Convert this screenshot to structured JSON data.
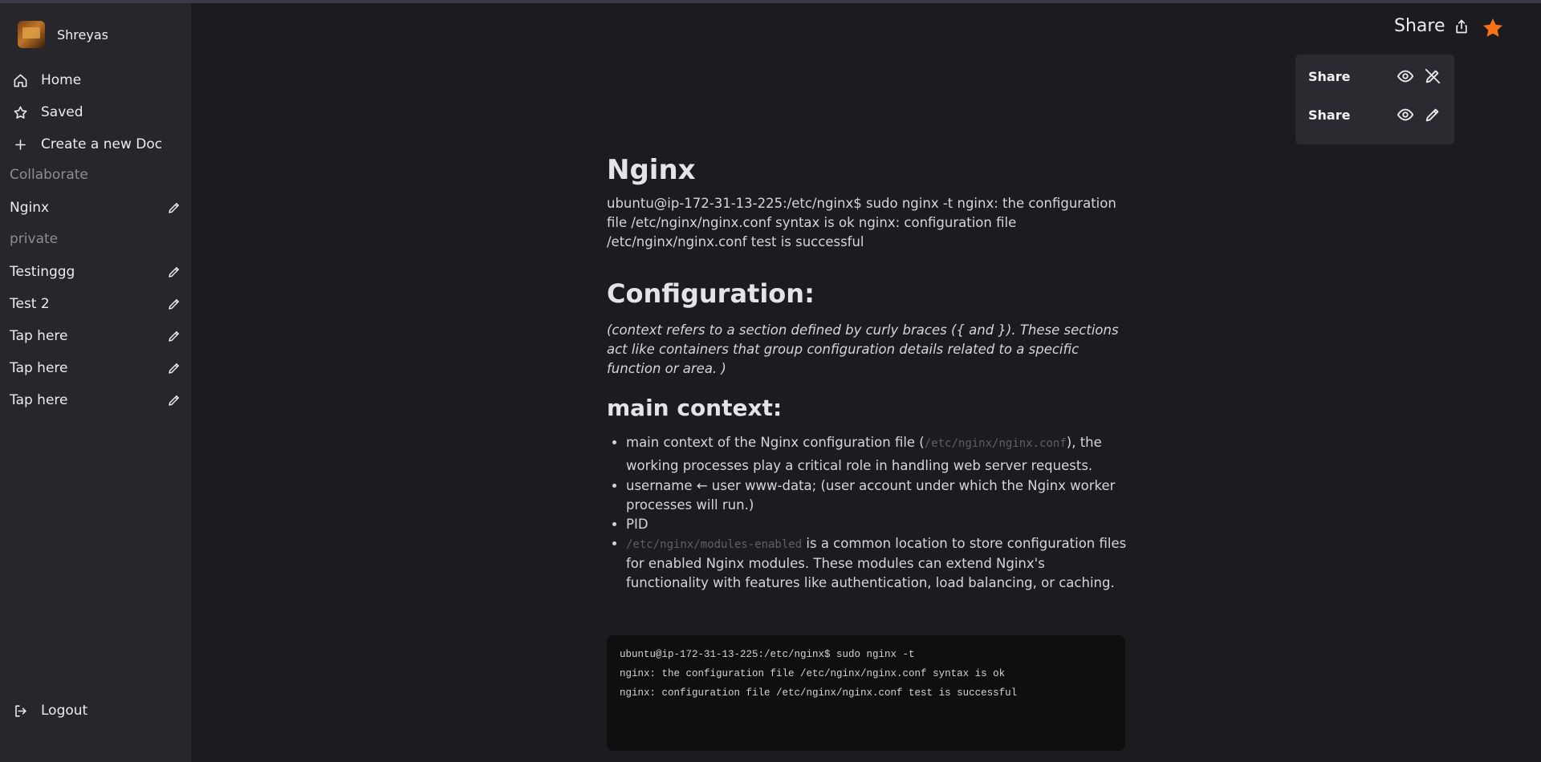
{
  "user": {
    "name": "Shreyas"
  },
  "nav": [
    {
      "label": "Home",
      "icon": "home-icon"
    },
    {
      "label": "Saved",
      "icon": "star-outline-icon"
    },
    {
      "label": "Create a new Doc",
      "icon": "plus-icon"
    }
  ],
  "sections": {
    "collaborate": "Collaborate",
    "private": "private"
  },
  "collaborate_docs": [
    {
      "label": "Nginx"
    }
  ],
  "private_docs": [
    {
      "label": "Testinggg"
    },
    {
      "label": "Test 2"
    },
    {
      "label": "Tap here"
    },
    {
      "label": "Tap here"
    },
    {
      "label": "Tap here"
    }
  ],
  "logout_label": "Logout",
  "header": {
    "share_label": "Share",
    "starred": true,
    "star_color": "#f97316"
  },
  "share_panel": [
    {
      "label": "Share",
      "icons": [
        "eye-icon",
        "edit-off-icon"
      ]
    },
    {
      "label": "Share",
      "icons": [
        "eye-icon",
        "pencil-icon"
      ]
    }
  ],
  "doc": {
    "title": "Nginx",
    "intro": "ubuntu@ip-172-31-13-225:/etc/nginx$ sudo nginx -t nginx: the configuration file /etc/nginx/nginx.conf syntax is ok nginx: configuration file /etc/nginx/nginx.conf test is successful",
    "config_heading": "Configuration:",
    "config_note": "(context refers to a section defined by curly braces ({ and }). These sections act like containers that group configuration details related to a specific function or area. )",
    "main_heading": "main context:",
    "bullets": {
      "b1_pre": "main context of the Nginx configuration file (",
      "b1_code": "/etc/nginx/nginx.conf",
      "b1_post": "), the working processes play a critical role in handling web server requests.",
      "b2": "username ← user www-data; (user account under which the Nginx worker processes will run.)",
      "b3": "PID",
      "b4_code": "/etc/nginx/modules-enabled",
      "b4_post": " is a common location to store configuration files for enabled Nginx modules. These modules can extend Nginx's functionality with features like authentication, load balancing, or caching."
    },
    "code_lines": [
      "ubuntu@ip-172-31-13-225:/etc/nginx$ sudo nginx -t",
      "nginx: the configuration file /etc/nginx/nginx.conf syntax is ok",
      "nginx: configuration file /etc/nginx/nginx.conf test is successful"
    ]
  }
}
